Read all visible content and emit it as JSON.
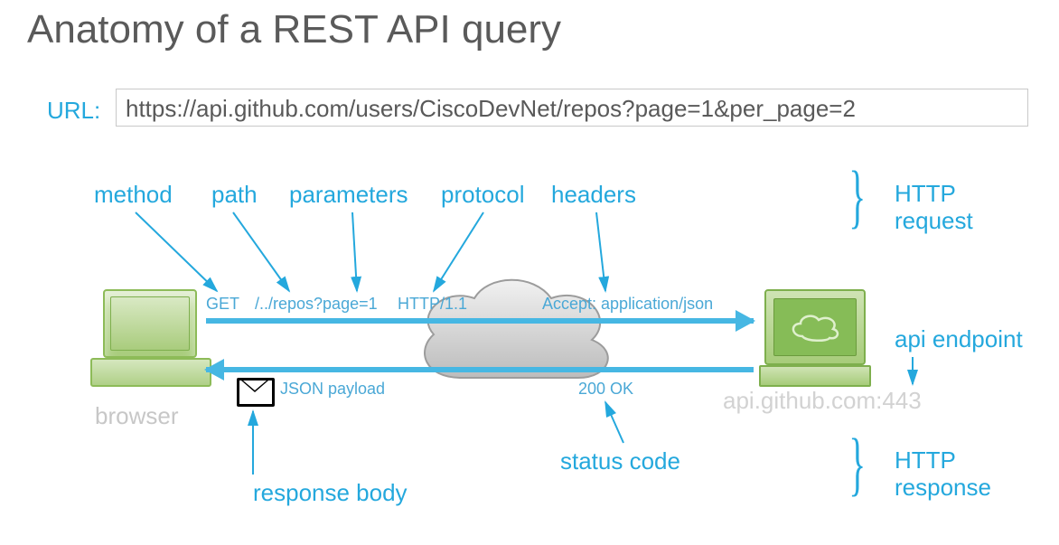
{
  "title": "Anatomy of a REST API query",
  "url": {
    "label": "URL:",
    "value": "https://api.github.com/users/CiscoDevNet/repos?page=1&per_page=2"
  },
  "browser_label": "browser",
  "callouts": {
    "method": "method",
    "path": "path",
    "parameters": "parameters",
    "protocol": "protocol",
    "headers": "headers",
    "status_code": "status code",
    "response_body": "response body",
    "api_endpoint": "api endpoint"
  },
  "request_line": {
    "method": "GET",
    "path": "/../repos?page=1",
    "protocol": "HTTP/1.1",
    "header": "Accept: application/json"
  },
  "response_line": {
    "payload": "JSON payload",
    "status": "200 OK"
  },
  "endpoint_host": "api.github.com:443",
  "braces": {
    "request": "HTTP\nrequest",
    "response": "HTTP\nresponse"
  }
}
